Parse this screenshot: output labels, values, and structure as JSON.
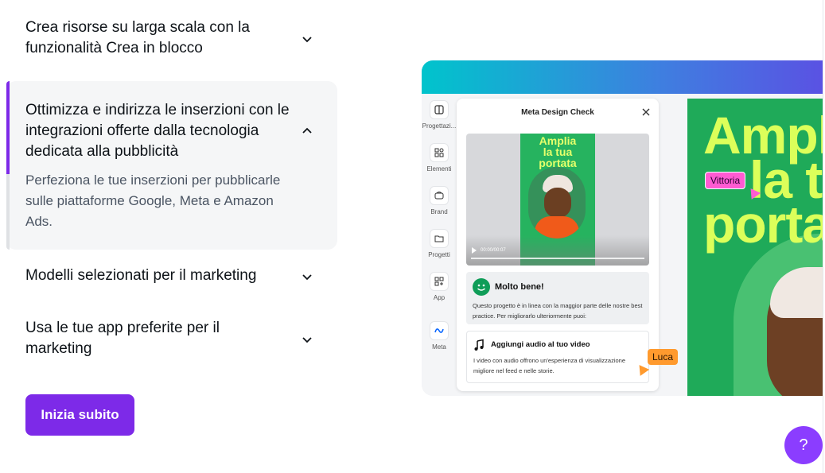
{
  "accordion": {
    "items": [
      {
        "title": "Crea risorse su larga scala con la funzionalità Crea in blocco",
        "expanded": false
      },
      {
        "title": "Ottimizza e indirizza le inserzioni con le integrazioni offerte dalla tecnologia dedicata alla pubblicità",
        "body": "Perfeziona le tue inserzioni per pubblicarle sulle piattaforme Google, Meta e Amazon Ads.",
        "expanded": true
      },
      {
        "title": "Modelli selezionati per il marketing",
        "expanded": false
      },
      {
        "title": "Usa le tue app preferite per il marketing",
        "expanded": false
      }
    ]
  },
  "cta": {
    "label": "Inizia subito"
  },
  "help": {
    "label": "?"
  },
  "mockup": {
    "rail": [
      {
        "label": "Progettazi...",
        "icon": "layout-icon"
      },
      {
        "label": "Elementi",
        "icon": "shapes-icon"
      },
      {
        "label": "Brand",
        "icon": "brand-icon"
      },
      {
        "label": "Progetti",
        "icon": "folder-icon"
      },
      {
        "label": "App",
        "icon": "apps-icon"
      },
      {
        "label": "Meta",
        "icon": "meta-icon"
      }
    ],
    "panel": {
      "title": "Meta Design Check",
      "video": {
        "poster_text": [
          "Amplia",
          "la tua",
          "portata"
        ],
        "time": "00:00/00:07"
      },
      "good": {
        "title": "Molto bene!",
        "text": "Questo progetto è in linea con la maggior parte delle nostre best practice. Per migliorarlo ulteriormente puoi:"
      },
      "audio": {
        "title": "Aggiungi audio al tuo video",
        "text": "I video con audio offrono un'esperienza di visualizzazione migliore nel feed e nelle storie."
      }
    },
    "canvas": {
      "lines": [
        "Ampli",
        "la tu",
        "portat"
      ]
    },
    "collaborators": {
      "vittoria": "Vittoria",
      "luca": "Luca"
    }
  },
  "colors": {
    "accent": "#7d2ae8",
    "help": "#8b3dff",
    "canvas_green": "#1faa59",
    "canvas_text": "#dcff5a"
  }
}
